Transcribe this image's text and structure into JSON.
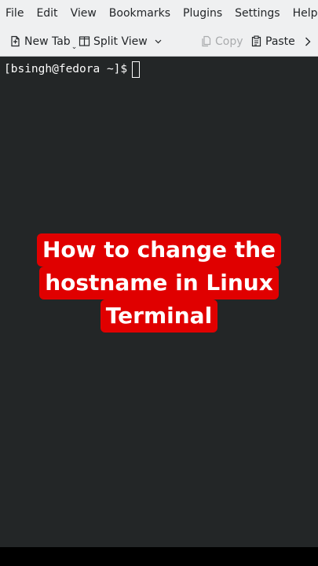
{
  "menubar": {
    "items": [
      "File",
      "Edit",
      "View",
      "Bookmarks",
      "Plugins",
      "Settings",
      "Help"
    ]
  },
  "toolbar": {
    "new_tab_label": "New Tab",
    "new_tab_icon": "new-tab-icon",
    "split_view_label": "Split View",
    "split_view_icon": "split-view-icon",
    "copy_label": "Copy",
    "copy_icon": "copy-icon",
    "copy_enabled": false,
    "paste_label": "Paste",
    "paste_icon": "paste-icon",
    "overflow_icon": "chevron-right-icon"
  },
  "terminal": {
    "prompt": "[bsingh@fedora ~]$",
    "background": "#232627",
    "foreground": "#fcfcfc"
  },
  "overlay": {
    "lines": [
      "How to change the",
      "hostname in Linux",
      "Terminal"
    ],
    "background": "#e00000",
    "text_color": "#ffffff"
  }
}
